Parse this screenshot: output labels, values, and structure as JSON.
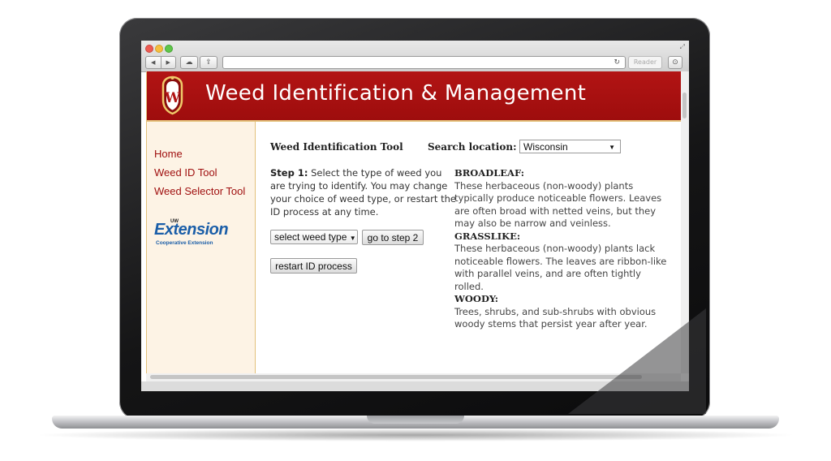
{
  "browser": {
    "reader_label": "Reader",
    "nav_back_icon": "◀",
    "nav_forward_icon": "▶"
  },
  "header": {
    "site_title": "Weed Identification & Management",
    "crest_letter": "W"
  },
  "sidebar": {
    "items": [
      {
        "label": "Home"
      },
      {
        "label": "Weed ID Tool"
      },
      {
        "label": "Weed Selector Tool"
      }
    ],
    "logo": {
      "uw": "UW",
      "word": "Extension",
      "sub": "Cooperative Extension"
    }
  },
  "main": {
    "tool_title": "Weed Identification Tool",
    "search_label": "Search location:",
    "location_value": "Wisconsin",
    "step_label": "Step 1:",
    "step_text": "Select the type of weed you are trying to identify. You may change your choice of weed type, or restart the ID process at any time.",
    "weed_select_value": "select weed type",
    "go_step2_label": "go to step 2",
    "restart_label": "restart ID process",
    "info": [
      {
        "heading": "BROADLEAF:",
        "text": "These herbaceous (non-woody) plants typically produce noticeable flowers. Leaves are often broad with netted veins, but they may also be narrow and veinless."
      },
      {
        "heading": "GRASSLIKE:",
        "text": "These herbaceous (non-woody) plants lack noticeable flowers. The leaves are ribbon-like with parallel veins, and are often tightly rolled."
      },
      {
        "heading": "WOODY:",
        "text": "Trees, shrubs, and sub-shrubs with obvious woody stems that persist year after year."
      }
    ]
  },
  "colors": {
    "header_red": "#b21414",
    "link_red": "#a01010",
    "sidebar_bg": "#fdf3e5",
    "gold_border": "#e3c07a",
    "extension_blue": "#1b5ea8"
  }
}
